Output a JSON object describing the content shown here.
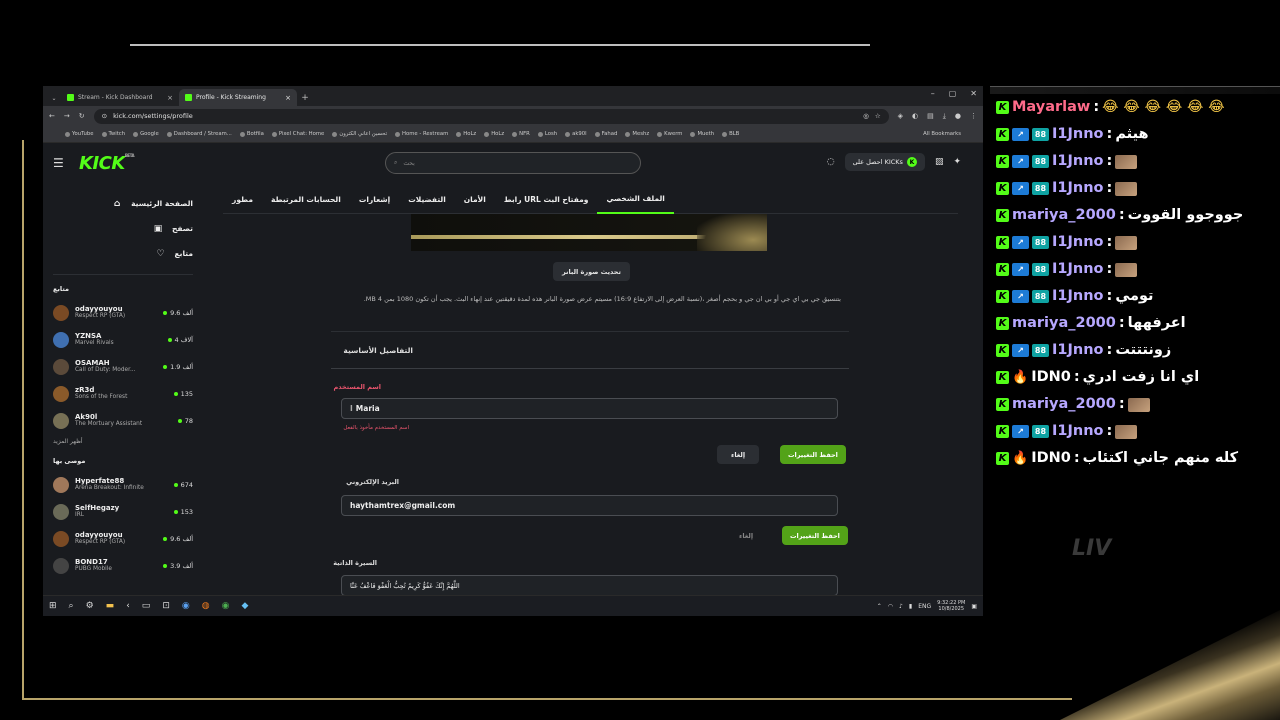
{
  "browser": {
    "tabs": [
      {
        "title": "Stream - Kick Dashboard",
        "active": false
      },
      {
        "title": "Profile - Kick Streaming",
        "active": true
      }
    ],
    "url": "kick.com/settings/profile",
    "bookmarks": [
      "YouTube",
      "Twitch",
      "Google",
      "Dashboard / Stream...",
      "Botfila",
      "Pixel Chat: Home",
      "تحسين اعاني الكترون",
      "Home - Restream",
      "HoLz",
      "HoLz",
      "NFR",
      "Losh",
      "ak90l",
      "Fahad",
      "Meshz",
      "Kwerm",
      "Mueth",
      "BLB"
    ],
    "all_bookmarks": "All Bookmarks"
  },
  "kick": {
    "logo": "KICK",
    "logo_sup": "BETA",
    "search_placeholder": "بحث",
    "get_kicks": "احصل على KICKs",
    "nav": [
      {
        "label": "الصفحة الرئيسية",
        "icon": "home-icon",
        "glyph": "⌂"
      },
      {
        "label": "تصفح",
        "icon": "browse-icon",
        "glyph": "▣"
      },
      {
        "label": "متابع",
        "icon": "heart-icon",
        "glyph": "♡"
      }
    ],
    "following_heading": "متابع",
    "following": [
      {
        "name": "odayyouyou",
        "category": "Respect RP (GTA)",
        "viewers": "9.6 ألف",
        "avatar": "#7a4a24"
      },
      {
        "name": "YZNSA",
        "category": "Marvel Rivals",
        "viewers": "4 آلاف",
        "avatar": "#3f6fb0"
      },
      {
        "name": "OSAMAH",
        "category": "Call of Duty: Moder...",
        "viewers": "1.9 ألف",
        "avatar": "#5b4a3a"
      },
      {
        "name": "zR3d",
        "category": "Sons of the Forest",
        "viewers": "135",
        "avatar": "#8a5a2a"
      },
      {
        "name": "Ak90l",
        "category": "The Mortuary Assistant",
        "viewers": "78",
        "avatar": "#777055"
      }
    ],
    "show_more": "أظهر المزيد",
    "recommended_heading": "موصى بها",
    "recommended": [
      {
        "name": "Hyperfate88",
        "category": "Arena Breakout: Infinite",
        "viewers": "674",
        "avatar": "#a0785a"
      },
      {
        "name": "SelfHegazy",
        "category": "IRL",
        "viewers": "153",
        "avatar": "#6a6a58"
      },
      {
        "name": "odayyouyou",
        "category": "Respect RP (GTA)",
        "viewers": "9.6 ألف",
        "avatar": "#7a4a24"
      },
      {
        "name": "BOND17",
        "category": "PUBG Mobile",
        "viewers": "3.9 ألف",
        "avatar": "#444"
      }
    ],
    "settings_tabs": [
      "الملف الشخصي",
      "رابط URL ومفتاح البث",
      "الأمان",
      "التفضيلات",
      "إشعارات",
      "الحسابات المرتبطة",
      "مطور"
    ],
    "update_banner_btn": "تحديث صورة البانر",
    "banner_note": "بتنسيق جي بي اي جي أو بي ان جي و بحجم أصغر ،(نسبة العرض إلى الارتفاع 16:9) مسيتم عرض صورة البانر هذه لمدة دقيقتين عند إنهاء البث. يجب أن تكون 1080 بمن 4 MB.",
    "basic_details": "التفاصيل الأساسية",
    "username_label": "اسم المستخدم",
    "username_value": "Maria",
    "username_error": "اسم المستخدم مأخوذ بالفعل",
    "save_label": "احفظ التغييرات",
    "cancel_label": "إلغاء",
    "email_label": "البريد الإلكتروني",
    "email_value": "haythamtrex@gmail.com",
    "bio_label": "السيرة الذاتية",
    "bio_value": "اللَّهُمَّ إِنَّكَ عَفُوٌّ كَرِيمٌ تُحِبُّ الْعَفْوَ فَاعْفُ عَنَّا"
  },
  "taskbar": {
    "lang": "ENG",
    "time": "9:32:22 PM",
    "date": "10/8/2025"
  },
  "chat": {
    "messages": [
      {
        "user": "Mayarlaw",
        "user_color": "#ff6b8a",
        "text": "😂 😂 😂 😂 😂 😂",
        "badges": false,
        "flame": false
      },
      {
        "user": "I1Jnno",
        "user_color": "#b7a8ff",
        "text": "هيثم",
        "badges": true,
        "flame": false
      },
      {
        "user": "I1Jnno",
        "user_color": "#b7a8ff",
        "text": "",
        "emote": true,
        "badges": true,
        "flame": false
      },
      {
        "user": "I1Jnno",
        "user_color": "#b7a8ff",
        "text": "",
        "emote": true,
        "badges": true,
        "flame": false
      },
      {
        "user": "mariya_2000",
        "user_color": "#b7a8ff",
        "text": "جووجوو القووت",
        "badges": false,
        "flame": false
      },
      {
        "user": "I1Jnno",
        "user_color": "#b7a8ff",
        "text": "",
        "emote": true,
        "badges": true,
        "flame": false
      },
      {
        "user": "I1Jnno",
        "user_color": "#b7a8ff",
        "text": "",
        "emote": true,
        "badges": true,
        "flame": false
      },
      {
        "user": "I1Jnno",
        "user_color": "#b7a8ff",
        "text": "تومي",
        "badges": true,
        "flame": false
      },
      {
        "user": "mariya_2000",
        "user_color": "#b7a8ff",
        "text": "اعرفهها",
        "badges": false,
        "flame": false
      },
      {
        "user": "I1Jnno",
        "user_color": "#b7a8ff",
        "text": "زونتتتت",
        "badges": true,
        "flame": false
      },
      {
        "user": "IDN0",
        "user_color": "#ffffff",
        "text": "اي انا زفت ادري",
        "badges": false,
        "flame": true
      },
      {
        "user": "mariya_2000",
        "user_color": "#b7a8ff",
        "text": "",
        "emote": true,
        "badges": false,
        "flame": false
      },
      {
        "user": "I1Jnno",
        "user_color": "#b7a8ff",
        "text": "",
        "emote": true,
        "badges": true,
        "flame": false
      },
      {
        "user": "IDN0",
        "user_color": "#ffffff",
        "text": "كله منهم جاني اكتئاب",
        "badges": false,
        "flame": true
      }
    ],
    "watermark": "LIV"
  }
}
